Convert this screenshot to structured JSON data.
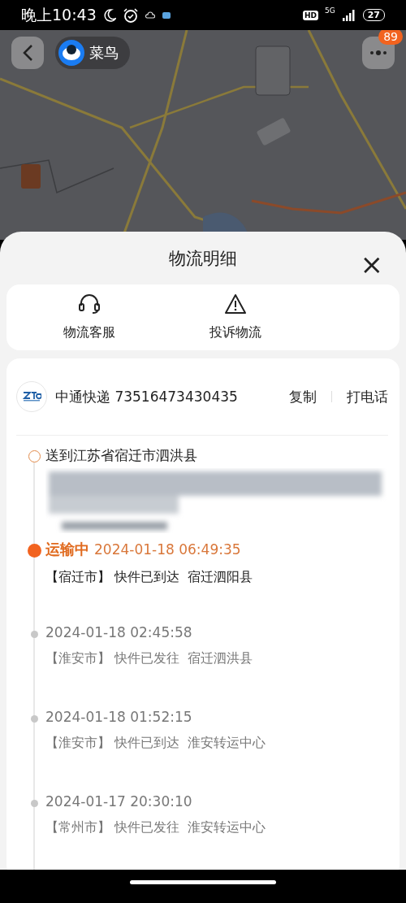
{
  "status_bar": {
    "time": "晚上10:43",
    "hd": "HD",
    "network": "5G",
    "battery": "27"
  },
  "header": {
    "app_name": "菜鸟",
    "badge": "89"
  },
  "sheet": {
    "title": "物流明细",
    "close": "×"
  },
  "actions": [
    {
      "kind": "service",
      "label": "物流客服"
    },
    {
      "kind": "complaint",
      "label": "投诉物流"
    }
  ],
  "shipment": {
    "carrier": "中通快递",
    "tracking_number": "73516473430435",
    "copy": "复制",
    "call": "打电话"
  },
  "timeline": [
    {
      "kind": "destination",
      "text": "送到江苏省宿迁市泗洪县"
    },
    {
      "kind": "current",
      "status": "运输中",
      "time": "2024-01-18 06:49:35",
      "detail": "【宿迁市】 快件已到达  宿迁泗阳县"
    },
    {
      "kind": "past",
      "time": "2024-01-18 02:45:58",
      "detail": "【淮安市】 快件已发往  宿迁泗洪县"
    },
    {
      "kind": "past",
      "time": "2024-01-18 01:52:15",
      "detail": "【淮安市】 快件已到达  淮安转运中心"
    },
    {
      "kind": "past",
      "time": "2024-01-17 20:30:10",
      "detail": "【常州市】 快件已发往  淮安转运中心"
    }
  ]
}
